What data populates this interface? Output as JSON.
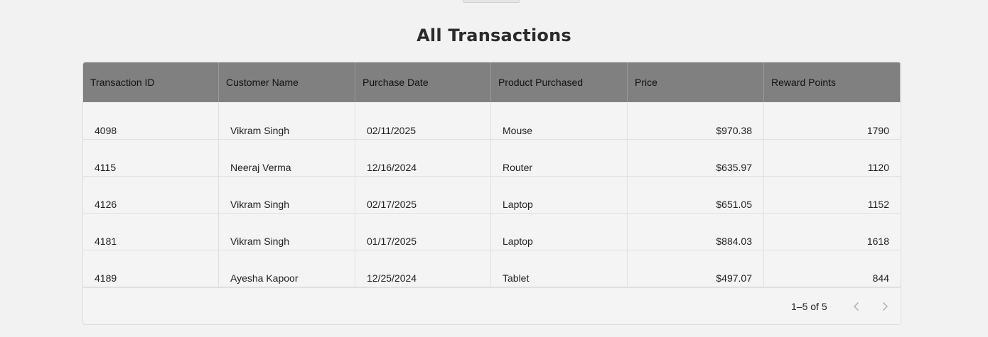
{
  "title": "All Transactions",
  "table": {
    "columns": [
      "Transaction ID",
      "Customer Name",
      "Purchase Date",
      "Product Purchased",
      "Price",
      "Reward Points"
    ],
    "rows": [
      [
        "4098",
        "Vikram Singh",
        "02/11/2025",
        "Mouse",
        "$970.38",
        "1790"
      ],
      [
        "4115",
        "Neeraj Verma",
        "12/16/2024",
        "Router",
        "$635.97",
        "1120"
      ],
      [
        "4126",
        "Vikram Singh",
        "02/17/2025",
        "Laptop",
        "$651.05",
        "1152"
      ],
      [
        "4181",
        "Vikram Singh",
        "01/17/2025",
        "Laptop",
        "$884.03",
        "1618"
      ],
      [
        "4189",
        "Ayesha Kapoor",
        "12/25/2024",
        "Tablet",
        "$497.07",
        "844"
      ]
    ]
  },
  "pagination": {
    "range_label": "1–5 of 5",
    "prev_icon": "chevron-left-icon",
    "next_icon": "chevron-right-icon"
  }
}
